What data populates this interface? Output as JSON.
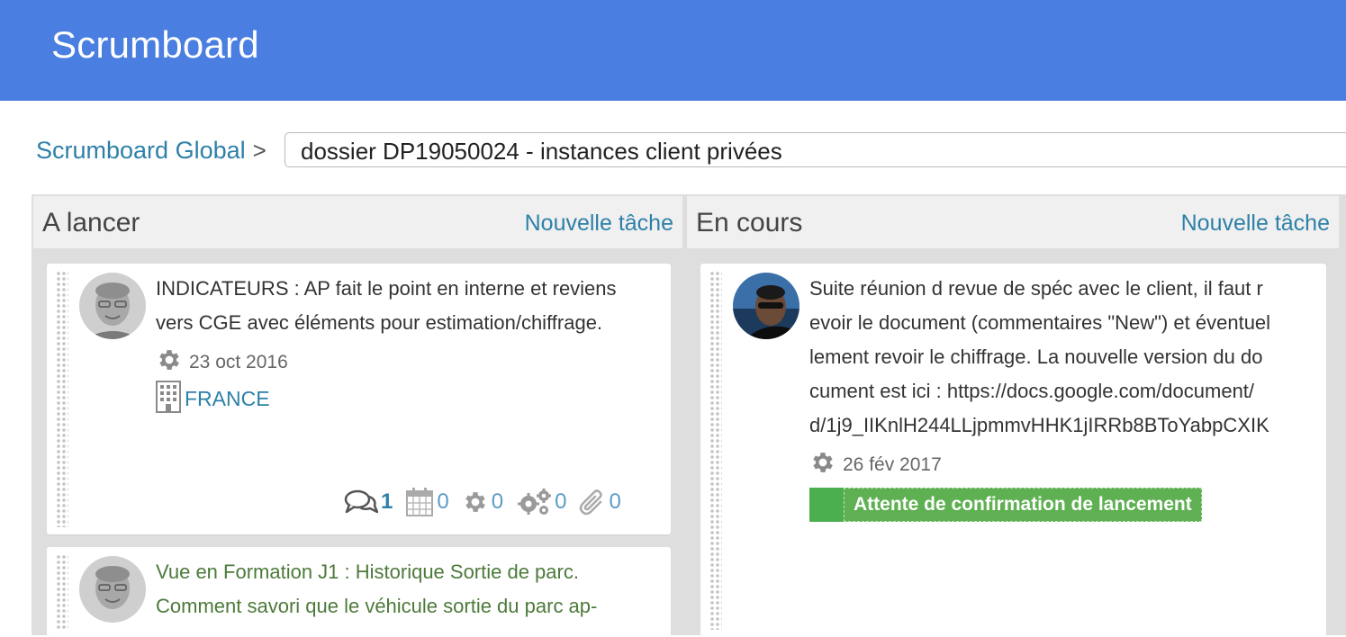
{
  "app": {
    "title": "Scrumboard"
  },
  "breadcrumb": {
    "root_label": "Scrumboard Global",
    "separator": ">",
    "project_value": "dossier DP19050024 - instances client privées"
  },
  "columns": [
    {
      "title": "A lancer",
      "new_task_label": "Nouvelle tâche",
      "cards": [
        {
          "text_line1": "INDICATEURS : AP fait le point en interne et reviens",
          "text_line2": "vers CGE avec éléments pour estimation/chiffrage.",
          "date": "23 oct 2016",
          "client": "FRANCE",
          "counters": {
            "comments": "1",
            "calendar": "0",
            "tasks": "0",
            "subtasks": "0",
            "attachments": "0"
          }
        },
        {
          "text_line1": "Vue en Formation J1 : Historique Sortie de parc.",
          "text_line2": "Comment savori que le véhicule sortie du parc ap-"
        }
      ]
    },
    {
      "title": "En cours",
      "new_task_label": "Nouvelle tâche",
      "cards": [
        {
          "text_line1": "Suite réunion d revue de spéc avec le client, il faut r",
          "text_line2": "evoir le document (commentaires \"New\") et éventuel",
          "text_line3": "lement revoir le chiffrage. La nouvelle version du do",
          "text_line4": "cument est ici : https://docs.google.com/document/",
          "text_line5": "d/1j9_IIKnlH244LLjpmmvHHK1jIRRb8BToYabpCXIK",
          "date": "26 fév 2017",
          "status": "Attente de confirmation de lancement",
          "status_color": "#5fb052"
        }
      ]
    }
  ],
  "icons": {
    "settings": "gear-icon",
    "client": "building-icon",
    "comments": "comments-icon",
    "calendar": "calendar-icon",
    "tasks": "gear-icon",
    "subtasks": "gears-icon",
    "attachments": "paperclip-icon"
  },
  "colors": {
    "header": "#4a7ee0",
    "link": "#2e80a8",
    "board": "#dedede"
  }
}
